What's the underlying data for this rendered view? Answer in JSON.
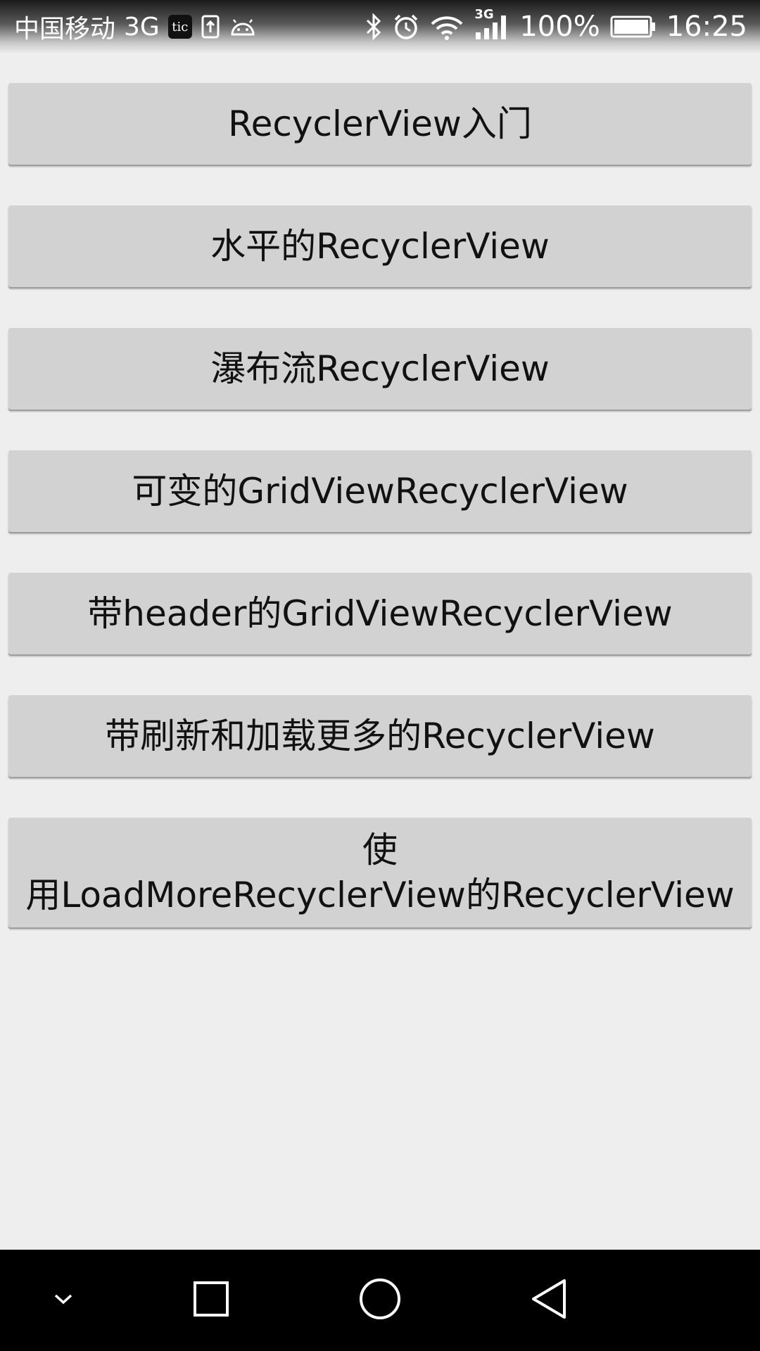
{
  "status_bar": {
    "carrier": "中国移动",
    "network": "3G",
    "tic_label": "tic",
    "network_small": "3G",
    "battery_percent": "100%",
    "time": "16:25"
  },
  "buttons": [
    {
      "label": "RecyclerView入门"
    },
    {
      "label": "水平的RecyclerView"
    },
    {
      "label": "瀑布流RecyclerView"
    },
    {
      "label": "可变的GridViewRecyclerView"
    },
    {
      "label": "带header的GridViewRecyclerView"
    },
    {
      "label": "带刷新和加载更多的RecyclerView"
    },
    {
      "label_line1": "使",
      "label_line2": "用LoadMoreRecyclerView的RecyclerView"
    }
  ],
  "nav_bar": {
    "icons": [
      "chevron-down-icon",
      "recents-square-icon",
      "home-circle-icon",
      "back-triangle-icon"
    ]
  },
  "colors": {
    "background": "#eeeeee",
    "button": "#d2d2d2",
    "nav_bar": "#000000"
  }
}
